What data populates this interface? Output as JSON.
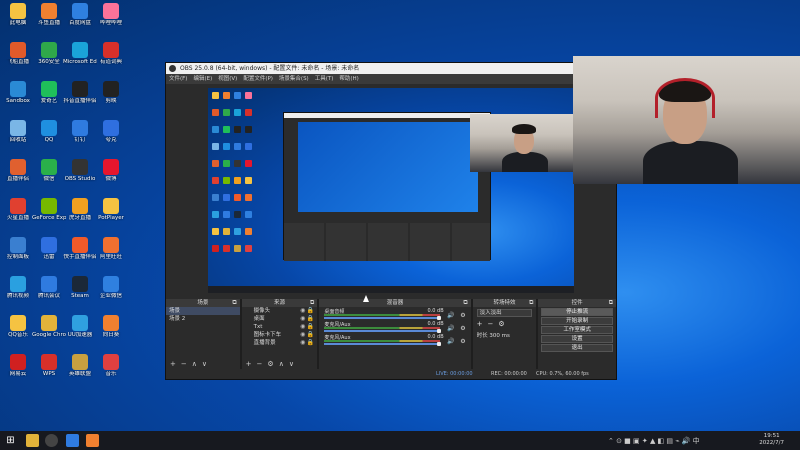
{
  "desktop": {
    "icons": [
      {
        "label": "此电脑",
        "color": "#f5c342"
      },
      {
        "label": "飞船直播",
        "color": "#e05a2a"
      },
      {
        "label": "Sandbox",
        "color": "#2a8ad5"
      },
      {
        "label": "回收站",
        "color": "#7ab6e6"
      },
      {
        "label": "直播伴侣",
        "color": "#e0602f"
      },
      {
        "label": "火星直播",
        "color": "#e04030"
      },
      {
        "label": "控制面板",
        "color": "#3a7fd0"
      },
      {
        "label": "腾讯视频",
        "color": "#2aa0e0"
      },
      {
        "label": "QQ音乐",
        "color": "#f5c342"
      },
      {
        "label": "网易云",
        "color": "#d02020"
      },
      {
        "label": "斗鱼直播",
        "color": "#f08030"
      },
      {
        "label": "360安全",
        "color": "#2fa84a"
      },
      {
        "label": "爱奇艺",
        "color": "#1fbf5a"
      },
      {
        "label": "QQ",
        "color": "#1f8fe0"
      },
      {
        "label": "微信",
        "color": "#2ab04a"
      },
      {
        "label": "GeForce Experience",
        "color": "#76b900"
      },
      {
        "label": "迅雷",
        "color": "#2f6fe0"
      },
      {
        "label": "腾讯会议",
        "color": "#2f7be0"
      },
      {
        "label": "Google Chrome",
        "color": "#e2b33a"
      },
      {
        "label": "WPS",
        "color": "#d8302a"
      },
      {
        "label": "百度网盘",
        "color": "#2f80e0"
      },
      {
        "label": "Microsoft Edge",
        "color": "#1aa3d9"
      },
      {
        "label": "抖音直播伴侣",
        "color": "#222"
      },
      {
        "label": "钉钉",
        "color": "#2f7be0"
      },
      {
        "label": "OBS Studio",
        "color": "#333"
      },
      {
        "label": "虎牙直播",
        "color": "#f0a020"
      },
      {
        "label": "快手直播伴侣",
        "color": "#f05a2a"
      },
      {
        "label": "Steam",
        "color": "#1b2838"
      },
      {
        "label": "UU加速器",
        "color": "#2fa0e0"
      },
      {
        "label": "英雄联盟",
        "color": "#c8a040"
      },
      {
        "label": "哔哩哔哩",
        "color": "#fb7299"
      },
      {
        "label": "有道词典",
        "color": "#d8302a"
      },
      {
        "label": "剪映",
        "color": "#222"
      },
      {
        "label": "夸克",
        "color": "#2f6fe0"
      },
      {
        "label": "微博",
        "color": "#e6162d"
      },
      {
        "label": "PotPlayer",
        "color": "#f5c342"
      },
      {
        "label": "阿里旺旺",
        "color": "#f07030"
      },
      {
        "label": "企业微信",
        "color": "#2f80e0"
      },
      {
        "label": "向日葵",
        "color": "#f08030"
      },
      {
        "label": "音乐",
        "color": "#e04040"
      }
    ]
  },
  "obs": {
    "title": "OBS 25.0.8 (64-bit, windows) - 配置文件: 未命名 - 场景: 未命名",
    "menu": [
      "文件(F)",
      "编辑(E)",
      "视图(V)",
      "配置文件(P)",
      "场景集合(S)",
      "工具(T)",
      "帮助(H)"
    ],
    "docks": {
      "scenes": {
        "header": "场景",
        "items": [
          "场景",
          "场景 2"
        ]
      },
      "sources": {
        "header": "来源",
        "items": [
          "摄像头",
          "桌面",
          "Txt",
          "图标卡下车",
          "直播背景"
        ]
      },
      "mixer": {
        "header": "混音器",
        "tracks": [
          {
            "name": "桌面音频",
            "db": "0.0 dB"
          },
          {
            "name": "麦克风/Aux",
            "db": "0.0 dB"
          },
          {
            "name": "麦克风/Aux",
            "db": "0.0 dB"
          }
        ]
      },
      "transitions": {
        "header": "转场特效",
        "selected": "淡入淡出",
        "duration_label": "时长",
        "duration": "300 ms"
      },
      "controls": {
        "header": "控件",
        "buttons": [
          "停止推流",
          "开始录制",
          "工作室模式",
          "设置",
          "退出"
        ]
      }
    },
    "status": {
      "live": "LIVE: 00:00:00",
      "rec": "REC: 00:00:00",
      "cpu": "CPU: 0.7%, 60.00 fps"
    }
  },
  "taskbar": {
    "time": "19:51",
    "date": "2022/7/7"
  }
}
